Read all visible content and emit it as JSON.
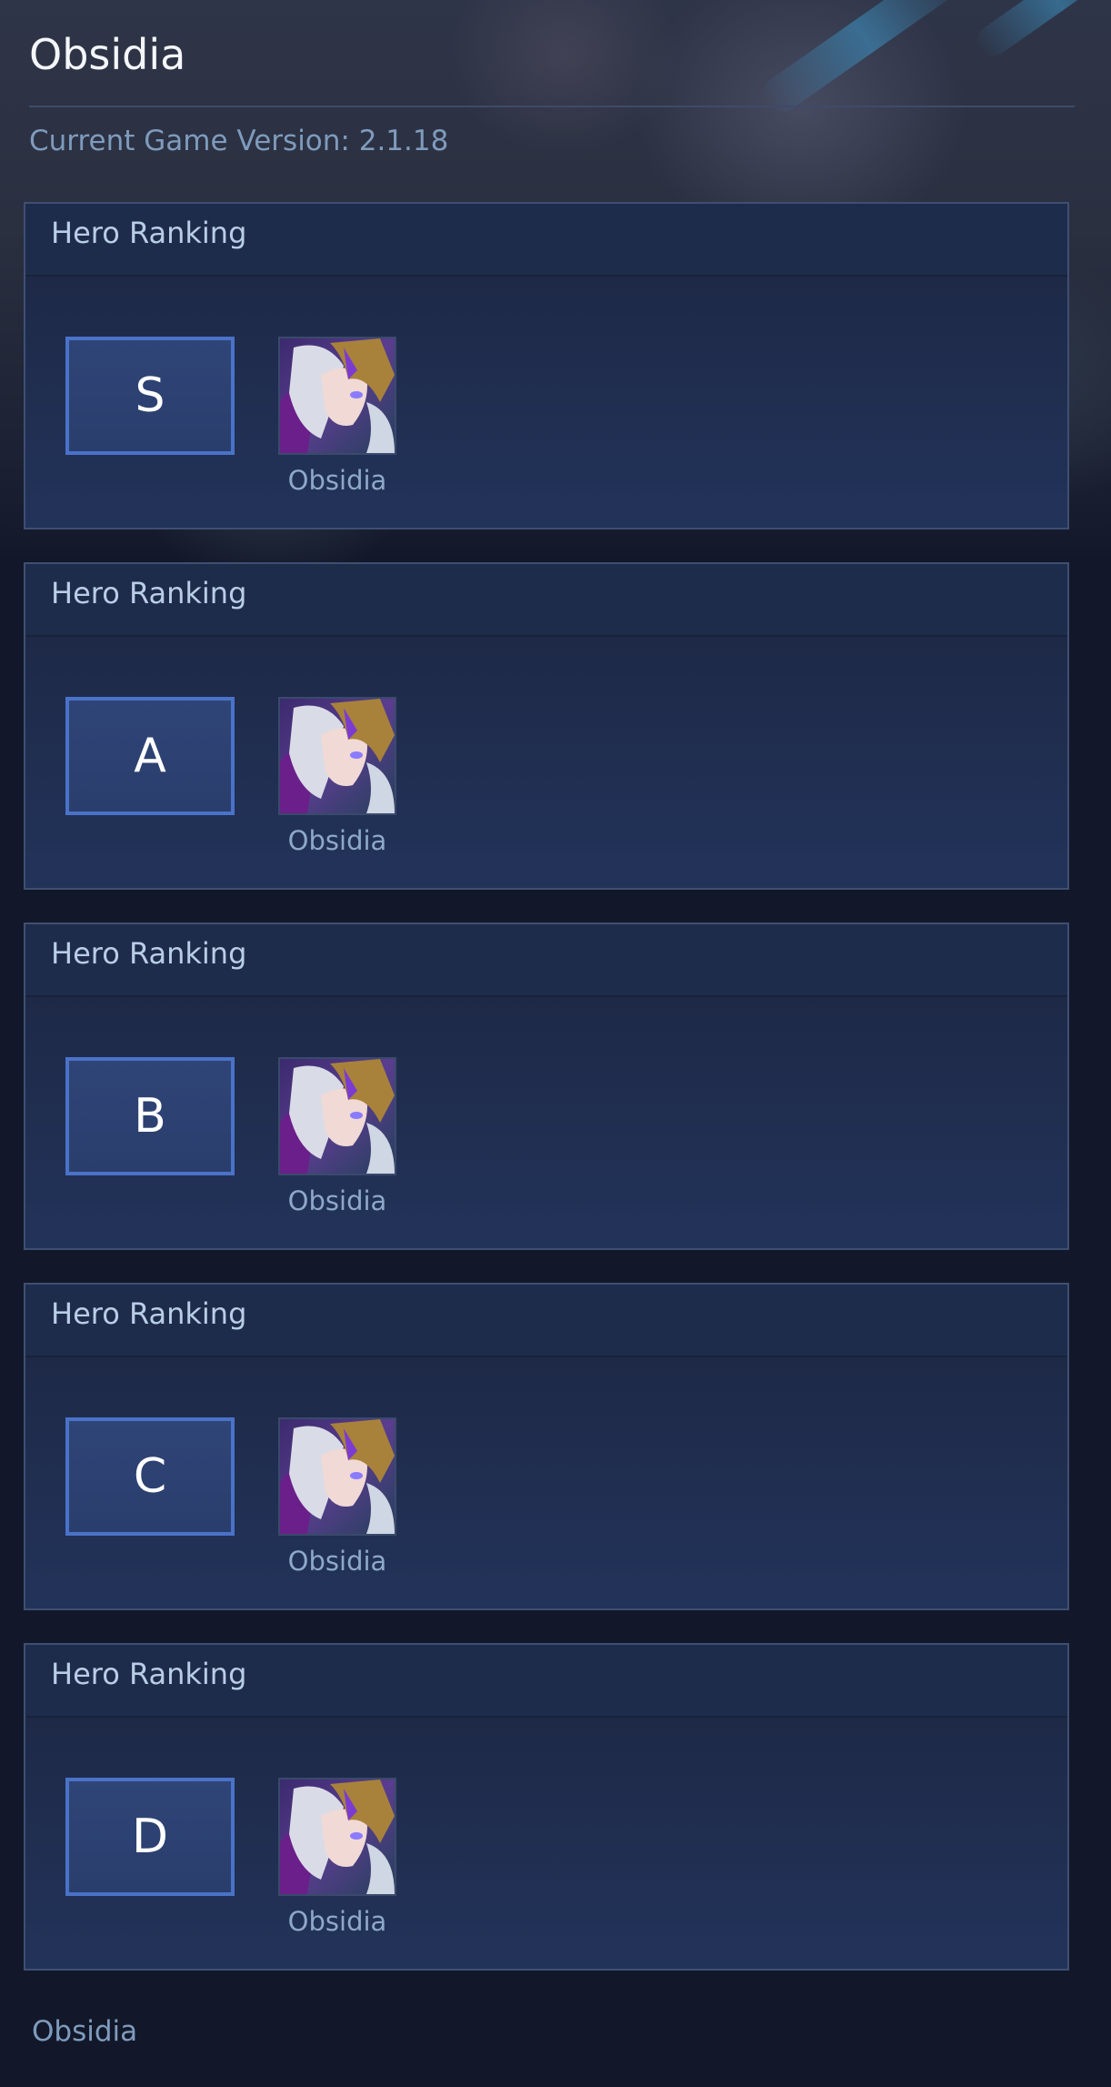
{
  "page": {
    "title": "Obsidia",
    "version_text": "Current Game Version: 2.1.18",
    "footer_text": "Obsidia"
  },
  "colors": {
    "background": "#121829",
    "card": "#1f2b47",
    "tier_border": "#4a72c8",
    "muted_text": "#7f9bbd"
  },
  "tiers": [
    {
      "header": "Hero Ranking",
      "tier": "S",
      "hero": {
        "name": "Obsidia",
        "portrait": "obsidia-portrait"
      }
    },
    {
      "header": "Hero Ranking",
      "tier": "A",
      "hero": {
        "name": "Obsidia",
        "portrait": "obsidia-portrait"
      }
    },
    {
      "header": "Hero Ranking",
      "tier": "B",
      "hero": {
        "name": "Obsidia",
        "portrait": "obsidia-portrait"
      }
    },
    {
      "header": "Hero Ranking",
      "tier": "C",
      "hero": {
        "name": "Obsidia",
        "portrait": "obsidia-portrait"
      }
    },
    {
      "header": "Hero Ranking",
      "tier": "D",
      "hero": {
        "name": "Obsidia",
        "portrait": "obsidia-portrait"
      }
    }
  ]
}
